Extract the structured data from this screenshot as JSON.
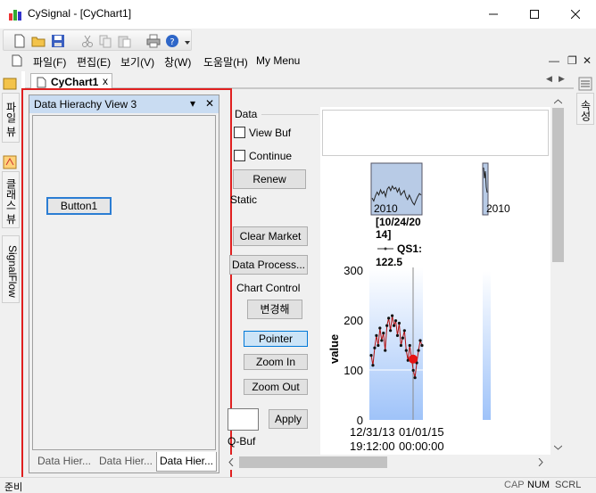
{
  "window": {
    "title": "CySignal - [CyChart1]",
    "minimize": "—",
    "maximize": "☐",
    "close": "✕"
  },
  "menu": {
    "items": [
      "파일(F)",
      "편집(E)",
      "보기(V)",
      "창(W)",
      "도움말(H)",
      "My Menu"
    ],
    "mdi_minimize": "—",
    "mdi_restore": "❐",
    "mdi_close": "✕"
  },
  "doc_tab": {
    "label": "CyChart1",
    "close": "x",
    "prev": "◀",
    "next": "▶",
    "close_all": "✕"
  },
  "left_side_tabs": [
    "파일 뷰",
    "클래스 뷰",
    "SignalFlow"
  ],
  "right_side_tabs": [
    "속성"
  ],
  "pane": {
    "title": "Data Hierachy View 3",
    "dropdown": "▾",
    "close": "✕",
    "button_label": "Button1",
    "tabs": [
      "Data Hier...",
      "Data Hier...",
      "Data Hier..."
    ],
    "active_tab": 2
  },
  "controls": {
    "data_group": "Data",
    "view_buf": "View Buf",
    "continue": "Continue",
    "renew": "Renew",
    "static": "Static",
    "clear_market": "Clear Market",
    "data_process": "Data Process...",
    "chart_control_group": "Chart Control",
    "change": "변경해",
    "pointer": "Pointer",
    "zoom_in": "Zoom In",
    "zoom_out": "Zoom Out",
    "apply": "Apply",
    "q_buf": "Q-Buf"
  },
  "chart": {
    "thumb1_label": "2010",
    "thumb2_label": "2010",
    "tooltip_line1": "[10/24/20",
    "tooltip_line2": "14]",
    "tooltip_series": "QS1:",
    "tooltip_value": "122.5",
    "y_label": "value",
    "y_ticks": [
      "300",
      "200",
      "100",
      "0"
    ],
    "x_ticks": [
      {
        "line1": "12/31/13",
        "line2": "19:12:00"
      },
      {
        "line1": "01/01/15",
        "line2": "00:00:00"
      }
    ]
  },
  "chart_data": {
    "type": "line",
    "ylabel": "value",
    "xlabel": "",
    "ylim": [
      0,
      300
    ],
    "x_range": [
      "12/31/13 19:12:00",
      "01/01/15 00:00:00"
    ],
    "series": [
      {
        "values": [
          130,
          110,
          145,
          170,
          150,
          185,
          160,
          175,
          140,
          190,
          205,
          180,
          210,
          190,
          200,
          170,
          195,
          150,
          165,
          180,
          140,
          120,
          150,
          125,
          100,
          85,
          115,
          140,
          160,
          150
        ]
      }
    ],
    "highlight_point": {
      "x": "10/24/2014",
      "y": 122.5
    },
    "accent_color": "#e51414"
  },
  "status": {
    "text": "준비",
    "caps": "CAP",
    "num": "NUM",
    "scrl": "SCRL"
  },
  "colors": {
    "highlight_frame": "#e02020",
    "pane_caption": "#c9dcf2",
    "chart_gradient_top": "#ffffff",
    "chart_gradient_bottom": "#9fc3f9"
  }
}
